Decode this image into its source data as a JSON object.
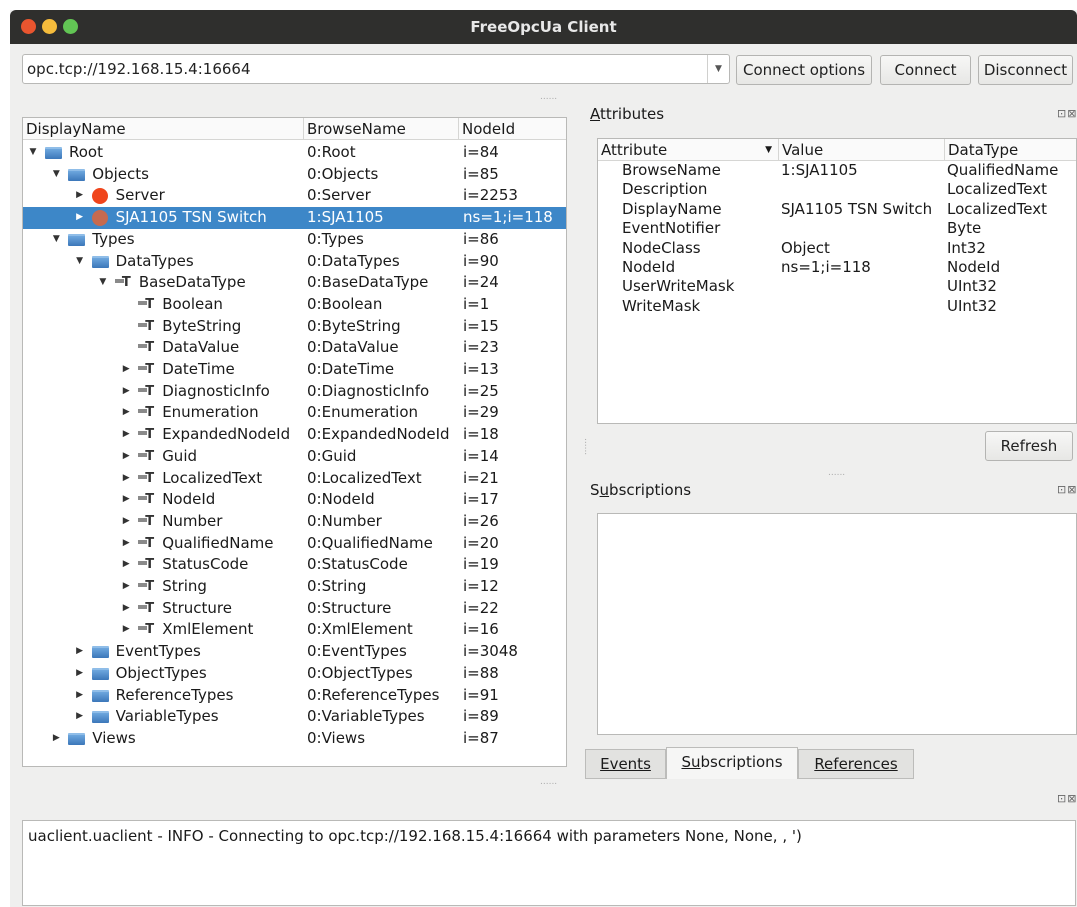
{
  "window": {
    "title": "FreeOpcUa Client"
  },
  "connection": {
    "url": "opc.tcp://192.168.15.4:16664",
    "connect_options": "Connect options",
    "connect": "Connect",
    "disconnect": "Disconnect"
  },
  "tree": {
    "columns": [
      "DisplayName",
      "BrowseName",
      "NodeId"
    ],
    "rows": [
      {
        "display": "Root",
        "browse": "0:Root",
        "nodeid": "i=84",
        "depth": 0,
        "expander": "open",
        "icon": "folder-icon"
      },
      {
        "display": "Objects",
        "browse": "0:Objects",
        "nodeid": "i=85",
        "depth": 1,
        "expander": "open",
        "icon": "folder-icon"
      },
      {
        "display": "Server",
        "browse": "0:Server",
        "nodeid": "i=2253",
        "depth": 2,
        "expander": "closed",
        "icon": "object-icon"
      },
      {
        "display": "SJA1105 TSN Switch",
        "browse": "1:SJA1105",
        "nodeid": "ns=1;i=118",
        "depth": 2,
        "expander": "closed",
        "icon": "object-icon",
        "selected": true
      },
      {
        "display": "Types",
        "browse": "0:Types",
        "nodeid": "i=86",
        "depth": 1,
        "expander": "open",
        "icon": "folder-icon"
      },
      {
        "display": "DataTypes",
        "browse": "0:DataTypes",
        "nodeid": "i=90",
        "depth": 2,
        "expander": "open",
        "icon": "folder-icon"
      },
      {
        "display": "BaseDataType",
        "browse": "0:BaseDataType",
        "nodeid": "i=24",
        "depth": 3,
        "expander": "open",
        "icon": "datatype-icon"
      },
      {
        "display": "Boolean",
        "browse": "0:Boolean",
        "nodeid": "i=1",
        "depth": 4,
        "expander": "none",
        "icon": "datatype-icon"
      },
      {
        "display": "ByteString",
        "browse": "0:ByteString",
        "nodeid": "i=15",
        "depth": 4,
        "expander": "none",
        "icon": "datatype-icon"
      },
      {
        "display": "DataValue",
        "browse": "0:DataValue",
        "nodeid": "i=23",
        "depth": 4,
        "expander": "none",
        "icon": "datatype-icon"
      },
      {
        "display": "DateTime",
        "browse": "0:DateTime",
        "nodeid": "i=13",
        "depth": 4,
        "expander": "closed",
        "icon": "datatype-icon"
      },
      {
        "display": "DiagnosticInfo",
        "browse": "0:DiagnosticInfo",
        "nodeid": "i=25",
        "depth": 4,
        "expander": "closed",
        "icon": "datatype-icon"
      },
      {
        "display": "Enumeration",
        "browse": "0:Enumeration",
        "nodeid": "i=29",
        "depth": 4,
        "expander": "closed",
        "icon": "datatype-icon"
      },
      {
        "display": "ExpandedNodeId",
        "browse": "0:ExpandedNodeId",
        "nodeid": "i=18",
        "depth": 4,
        "expander": "closed",
        "icon": "datatype-icon"
      },
      {
        "display": "Guid",
        "browse": "0:Guid",
        "nodeid": "i=14",
        "depth": 4,
        "expander": "closed",
        "icon": "datatype-icon"
      },
      {
        "display": "LocalizedText",
        "browse": "0:LocalizedText",
        "nodeid": "i=21",
        "depth": 4,
        "expander": "closed",
        "icon": "datatype-icon"
      },
      {
        "display": "NodeId",
        "browse": "0:NodeId",
        "nodeid": "i=17",
        "depth": 4,
        "expander": "closed",
        "icon": "datatype-icon"
      },
      {
        "display": "Number",
        "browse": "0:Number",
        "nodeid": "i=26",
        "depth": 4,
        "expander": "closed",
        "icon": "datatype-icon"
      },
      {
        "display": "QualifiedName",
        "browse": "0:QualifiedName",
        "nodeid": "i=20",
        "depth": 4,
        "expander": "closed",
        "icon": "datatype-icon"
      },
      {
        "display": "StatusCode",
        "browse": "0:StatusCode",
        "nodeid": "i=19",
        "depth": 4,
        "expander": "closed",
        "icon": "datatype-icon"
      },
      {
        "display": "String",
        "browse": "0:String",
        "nodeid": "i=12",
        "depth": 4,
        "expander": "closed",
        "icon": "datatype-icon"
      },
      {
        "display": "Structure",
        "browse": "0:Structure",
        "nodeid": "i=22",
        "depth": 4,
        "expander": "closed",
        "icon": "datatype-icon"
      },
      {
        "display": "XmlElement",
        "browse": "0:XmlElement",
        "nodeid": "i=16",
        "depth": 4,
        "expander": "closed",
        "icon": "datatype-icon"
      },
      {
        "display": "EventTypes",
        "browse": "0:EventTypes",
        "nodeid": "i=3048",
        "depth": 2,
        "expander": "closed",
        "icon": "folder-icon"
      },
      {
        "display": "ObjectTypes",
        "browse": "0:ObjectTypes",
        "nodeid": "i=88",
        "depth": 2,
        "expander": "closed",
        "icon": "folder-icon"
      },
      {
        "display": "ReferenceTypes",
        "browse": "0:ReferenceTypes",
        "nodeid": "i=91",
        "depth": 2,
        "expander": "closed",
        "icon": "folder-icon"
      },
      {
        "display": "VariableTypes",
        "browse": "0:VariableTypes",
        "nodeid": "i=89",
        "depth": 2,
        "expander": "closed",
        "icon": "folder-icon"
      },
      {
        "display": "Views",
        "browse": "0:Views",
        "nodeid": "i=87",
        "depth": 1,
        "expander": "closed",
        "icon": "folder-icon"
      }
    ]
  },
  "attributes": {
    "title": "Attributes",
    "columns": [
      "Attribute",
      "Value",
      "DataType"
    ],
    "rows": [
      {
        "attribute": "BrowseName",
        "value": "1:SJA1105",
        "datatype": "QualifiedName"
      },
      {
        "attribute": "Description",
        "value": "",
        "datatype": "LocalizedText"
      },
      {
        "attribute": "DisplayName",
        "value": "SJA1105 TSN Switch",
        "datatype": "LocalizedText"
      },
      {
        "attribute": "EventNotifier",
        "value": "",
        "datatype": "Byte"
      },
      {
        "attribute": "NodeClass",
        "value": "Object",
        "datatype": "Int32"
      },
      {
        "attribute": "NodeId",
        "value": "ns=1;i=118",
        "datatype": "NodeId"
      },
      {
        "attribute": "UserWriteMask",
        "value": "",
        "datatype": "UInt32"
      },
      {
        "attribute": "WriteMask",
        "value": "",
        "datatype": "UInt32"
      }
    ],
    "refresh": "Refresh"
  },
  "subscriptions": {
    "title": "Subscriptions"
  },
  "tabs": [
    {
      "label": "Events",
      "active": false
    },
    {
      "label": "Subscriptions",
      "active": true
    },
    {
      "label": "References",
      "active": false
    }
  ],
  "log": {
    "line": "uaclient.uaclient - INFO - Connecting to opc.tcp://192.168.15.4:16664 with parameters None, None, , ')"
  },
  "colors": {
    "selection": "#3d87c8",
    "titlebar": "#2f2f2d",
    "folder": "#4a86c7",
    "object": "#f0451c"
  }
}
